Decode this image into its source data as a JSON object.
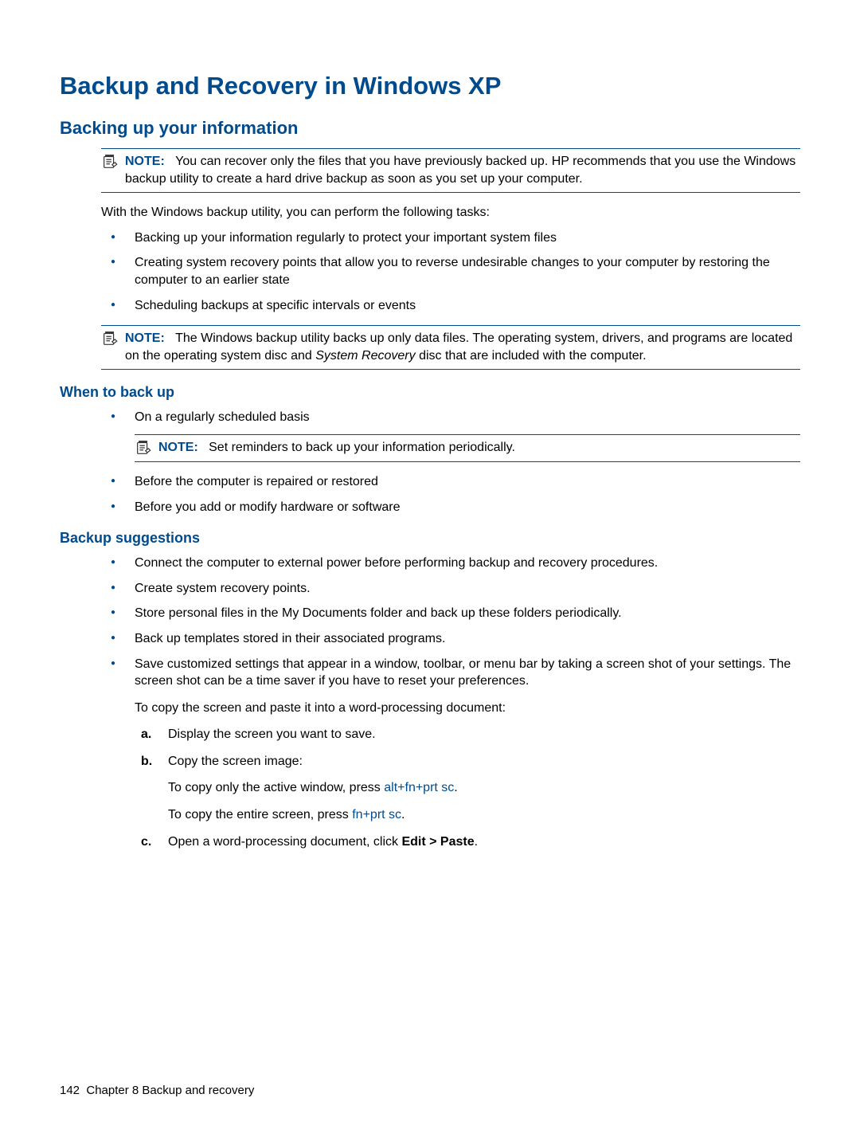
{
  "title": "Backup and Recovery in Windows XP",
  "section1": {
    "heading": "Backing up your information",
    "note1": {
      "label": "NOTE:",
      "text": "You can recover only the files that you have previously backed up. HP recommends that you use the Windows backup utility to create a hard drive backup as soon as you set up your computer."
    },
    "intro": "With the Windows backup utility, you can perform the following tasks:",
    "bullets": [
      "Backing up your information regularly to protect your important system files",
      "Creating system recovery points that allow you to reverse undesirable changes to your computer by restoring the computer to an earlier state",
      "Scheduling backups at specific intervals or events"
    ],
    "note2": {
      "label": "NOTE:",
      "text_before_italic": "The Windows backup utility backs up only data files. The operating system, drivers, and programs are located on the operating system disc and ",
      "italic": "System Recovery",
      "text_after_italic": " disc that are included with the computer."
    }
  },
  "section2": {
    "heading": "When to back up",
    "bullets_top": [
      "On a regularly scheduled basis"
    ],
    "note": {
      "label": "NOTE:",
      "text": "Set reminders to back up your information periodically."
    },
    "bullets_bottom": [
      "Before the computer is repaired or restored",
      "Before you add or modify hardware or software"
    ]
  },
  "section3": {
    "heading": "Backup suggestions",
    "bullets": [
      "Connect the computer to external power before performing backup and recovery procedures.",
      "Create system recovery points.",
      "Store personal files in the My Documents folder and back up these folders periodically.",
      "Back up templates stored in their associated programs."
    ],
    "bullet5": {
      "text": "Save customized settings that appear in a window, toolbar, or menu bar by taking a screen shot of your settings. The screen shot can be a time saver if you have to reset your preferences.",
      "sub_intro": "To copy the screen and paste it into a word-processing document:",
      "steps": {
        "a": "Display the screen you want to save.",
        "b": "Copy the screen image:",
        "b_sub1_before": "To copy only the active window, press ",
        "b_sub1_key": "alt+fn+prt sc",
        "b_sub2_before": "To copy the entire screen, press ",
        "b_sub2_key": "fn+prt sc",
        "c_before": "Open a word-processing document, click ",
        "c_bold": "Edit > Paste",
        "period": "."
      }
    }
  },
  "footer": {
    "page_num": "142",
    "chapter": "Chapter 8   Backup and recovery"
  }
}
